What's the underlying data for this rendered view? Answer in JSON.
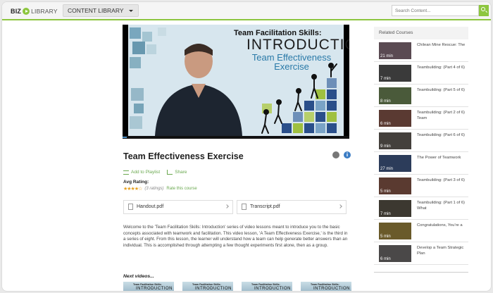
{
  "header": {
    "logo_biz": "BIZ",
    "logo_library": "LIBRARY",
    "category": "CONTENT LIBRARY",
    "search_placeholder": "Search Content..."
  },
  "video": {
    "title_line1": "Team Facilitation Skills:",
    "title_line2": "INTRODUCTION",
    "title_line3": "Team Effectiveness Exercise",
    "progress_fraction": 0.02
  },
  "course": {
    "title": "Team Effectiveness Exercise",
    "add_to_playlist": "Add to Playlist",
    "share": "Share",
    "avg_rating_label": "Avg Rating:",
    "stars": "★★★★☆",
    "rating_value": 4,
    "ratings_count": "(3 ratings)",
    "rate_link": "Rate this course",
    "files": [
      {
        "name": "Handout.pdf"
      },
      {
        "name": "Transcript.pdf"
      }
    ],
    "description": "Welcome to the 'Team Facilitation Skills: Introduction' series of video lessons meant to introduce you to the basic concepts associated with teamwork and facilitation. This video lesson, 'A Team Effectiveness Exercise,' is the third in a series of eight. From this lesson, the learner will understand how a team can help generate better answers than an individual. This is accomplished through attempting a few thought experiments first alone, then as a group.",
    "next_videos_label": "Next videos...",
    "next_videos": [
      {
        "line1": "Team Facilitation Skills:",
        "line2": "INTRODUCTION"
      },
      {
        "line1": "Team Facilitation Skills:",
        "line2": "INTRODUCTION"
      },
      {
        "line1": "Team Facilitation Skills:",
        "line2": "INTRODUCTION"
      },
      {
        "line1": "Team Facilitation Skills:",
        "line2": "INTRODUCTION"
      }
    ]
  },
  "sidebar": {
    "heading": "Related Courses",
    "items": [
      {
        "duration": "21 min",
        "title": "Chilean Mine Rescue: The",
        "thumb_color": "#5a4a52"
      },
      {
        "duration": "7 min",
        "title": "Teambuilding: (Part 4 of 6)",
        "thumb_color": "#3a3a3a"
      },
      {
        "duration": "8 min",
        "title": "Teambuilding: (Part 5 of 6)",
        "thumb_color": "#4a5a3a"
      },
      {
        "duration": "6 min",
        "title": "Teambuilding: (Part 2 of 6) Team",
        "thumb_color": "#5a3a32"
      },
      {
        "duration": "9 min",
        "title": "Teambuilding: (Part 6 of 6)",
        "thumb_color": "#44403c"
      },
      {
        "duration": "27 min",
        "title": "The Power of Teamwork",
        "thumb_color": "#2c3c5a"
      },
      {
        "duration": "5 min",
        "title": "Teambuilding: (Part 3 of 6)",
        "thumb_color": "#5a3a30"
      },
      {
        "duration": "7 min",
        "title": "Teambuilding: (Part 1 of 6) What",
        "thumb_color": "#3c3830"
      },
      {
        "duration": "5 min",
        "title": "Congratulations, You're a",
        "thumb_color": "#6a5a2a"
      },
      {
        "duration": "6 min",
        "title": "Develop a Team Strategic Plan",
        "thumb_color": "#4a4848"
      }
    ]
  },
  "colors": {
    "accent": "#8dc63f",
    "link": "#6aa84f",
    "info": "#3b7cc4",
    "star": "#e6a020"
  },
  "icons": [
    "play-logo-icon",
    "caret-down-icon",
    "search-icon",
    "share-circle-icon",
    "info-icon",
    "playlist-icon",
    "share-icon",
    "document-icon",
    "chevron-right-icon"
  ]
}
